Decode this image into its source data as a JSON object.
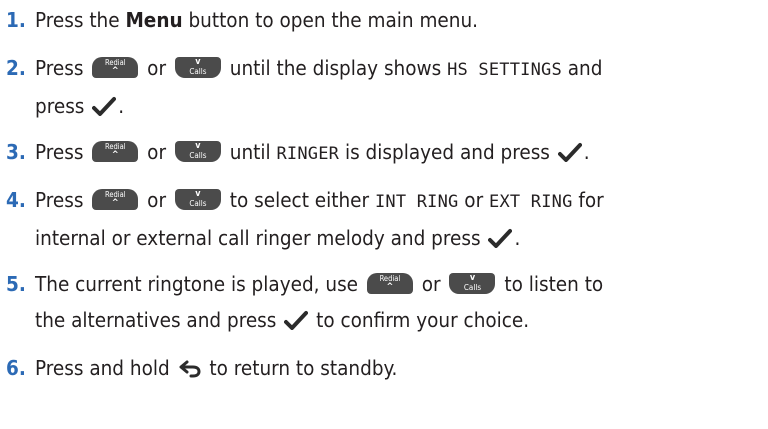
{
  "steps": [
    {
      "num": "1.",
      "p1": "Press the ",
      "b1": "Menu",
      "p2": " button to open the main menu."
    },
    {
      "num": "2.",
      "p1": "Press ",
      "p2": " or ",
      "p3": " until the display shows ",
      "m1": "HS SETTINGS",
      "p4": " and",
      "l2": "press ",
      "l2end": "."
    },
    {
      "num": "3.",
      "p1": "Press ",
      "p2": " or ",
      "p3": " until ",
      "m1": "RINGER",
      "p4": " is displayed and press ",
      "p5": "."
    },
    {
      "num": "4.",
      "p1": "Press ",
      "p2": " or ",
      "p3": " to select either ",
      "m1": "INT RING",
      "p4": " or ",
      "m2": "EXT RING",
      "p5": " for",
      "l2": "internal or external call ringer melody and press ",
      "l2end": "."
    },
    {
      "num": "5.",
      "p1": "The current ringtone is played, use ",
      "p2": " or ",
      "p3": " to listen to",
      "l2": "the alternatives and press ",
      "l2b": " to confirm your choice."
    },
    {
      "num": "6.",
      "p1": "Press and hold ",
      "p2": " to return to standby."
    }
  ],
  "keys": {
    "redial_label": "Redial",
    "redial_symbol": "^",
    "calls_label": "Calls",
    "calls_symbol": "v"
  },
  "icons": {
    "check": "check-icon",
    "back": "back-arrow-icon"
  },
  "colors": {
    "step_number": "#2c6ab5",
    "text": "#231f20",
    "key_fill": "#4b4b4b"
  }
}
